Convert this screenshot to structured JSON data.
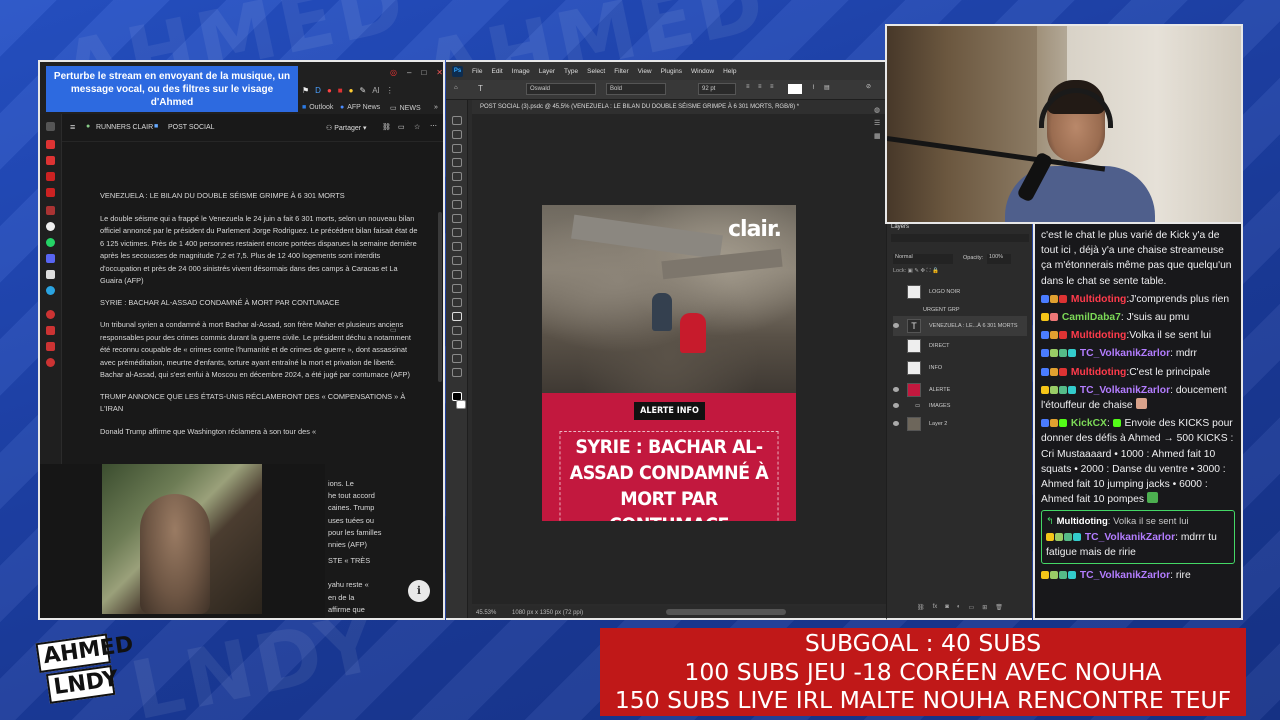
{
  "left_panel": {
    "banner_text": "Perturbe le stream en envoyant de la musique, un message vocal, ou des filtres sur le visage d'Ahmed",
    "bookmarks": [
      "Outlook",
      "AFP News",
      "NEWS"
    ],
    "breadcrumb": [
      "RUNNERS CLAIR",
      "POST SOCIAL"
    ],
    "share_label": "Partager",
    "doc": [
      {
        "type": "heading",
        "text": "VENEZUELA : LE BILAN DU DOUBLE SÉISME GRIMPE À 6 301 MORTS"
      },
      {
        "type": "para",
        "text": "Le double séisme qui a frappé le Venezuela le 24 juin a fait 6 301 morts, selon un nouveau bilan officiel annoncé par le président du Parlement Jorge Rodriguez. Le précédent bilan faisait état de 6 125 victimes. Près de 1 400 personnes restaient encore portées disparues la semaine dernière après les secousses de magnitude 7,2 et 7,5. Plus de 12 400 logements sont interdits d'occupation et près de 24 000 sinistrés vivent désormais dans des camps à Caracas et La Guaira (AFP)"
      },
      {
        "type": "heading",
        "text": "SYRIE : BACHAR AL-ASSAD CONDAMNÉ À MORT PAR CONTUMACE"
      },
      {
        "type": "para",
        "text": "Un tribunal syrien a condamné à mort Bachar al-Assad, son frère Maher et plusieurs anciens responsables pour des crimes commis durant la guerre civile. Le président déchu a notamment été reconnu coupable de « crimes contre l'humanité et de crimes de guerre », dont assassinat avec préméditation, meurtre d'enfants, torture ayant entraîné la mort et privation de liberté. Bachar al-Assad, qui s'est enfui à Moscou en décembre 2024, a été jugé par contumace (AFP)"
      },
      {
        "type": "heading",
        "text": "TRUMP ANNONCE QUE LES ÉTATS-UNIS RÉCLAMERONT DES « COMPENSATIONS » À L'IRAN"
      },
      {
        "type": "para",
        "text": "Donald Trump affirme que Washington réclamera à son tour des «"
      }
    ],
    "doc_fragments": [
      "ions. Le",
      "he tout accord",
      "caines. Trump",
      "uses tuées ou",
      "pour les familles",
      "nnies (AFP)",
      "STE « TRÈS",
      "yahu reste «",
      "en de la",
      "affirme que"
    ]
  },
  "photoshop": {
    "menu": [
      "File",
      "Edit",
      "Image",
      "Layer",
      "Type",
      "Select",
      "Filter",
      "View",
      "Plugins",
      "Window",
      "Help"
    ],
    "font_name": "Oswald",
    "font_style": "Bold",
    "font_size": "92 pt",
    "doc_tab": "POST SOCIAL (3).psdc @ 45,5% (VENEZUELA : LE BILAN DU DOUBLE SÉISME GRIMPE À 6 301 MORTS, RGB/8) *",
    "zoom": "45.53%",
    "doc_size": "1080 px x 1350 px (72 ppi)",
    "post": {
      "logo": "clair.",
      "label": "ALERTE INFO",
      "title": "SYRIE : BACHAR AL-ASSAD CONDAMNÉ À MORT PAR CONTUMACE"
    },
    "layers_title": "Layers",
    "blend_mode": "Normal",
    "opacity_label": "Opacity:",
    "opacity_value": "100%",
    "layers": [
      "LOGO NOIR",
      "URGENT GRP",
      "VENEZUELA : LE...À 6 301 MORTS",
      "DIRECT",
      "INFO",
      "ALERTE",
      "IMAGES",
      "Layer 2"
    ]
  },
  "chat": {
    "messages": [
      {
        "user": "",
        "text": "c'est le chat le plus varié de Kick y'a de tout ici , déjà y'a une chaise streameuse ça m'étonnerais même pas que quelqu'un dans le chat se sente table."
      },
      {
        "user": "Multidoting",
        "text": "J'comprends plus rien",
        "color": "u1"
      },
      {
        "user": "CamilDaba7",
        "text": "J'suis au pmu",
        "color": "u3"
      },
      {
        "user": "Multidoting",
        "text": "Volka il se sent lui",
        "color": "u1"
      },
      {
        "user": "TC_VolkanikZarlor",
        "text": "mdrr",
        "color": "u2"
      },
      {
        "user": "Multidoting",
        "text": "C'est le principale",
        "color": "u1"
      },
      {
        "user": "TC_VolkanikZarlor",
        "text": "doucement l'étouffeur de chaise",
        "color": "u2"
      },
      {
        "user": "KickCX",
        "text": "Envoie des KICKS pour donner des défis à Ahmed → 500 KICKS : Cri Mustaaaard • 1000 : Ahmed fait 10 squats • 2000 : Danse du ventre • 3000 : Ahmed fait 10 jumping jacks • 6000 : Ahmed fait 10 pompes",
        "color": "u3"
      }
    ],
    "reply": {
      "to_user": "Multidoting",
      "to_text": "Volka il se sent lui",
      "user": "TC_VolkanikZarlor",
      "text": "mdrrr tu fatigue mais de ririe"
    },
    "last": {
      "user": "TC_VolkanikZarlor",
      "text": "rire"
    }
  },
  "subgoal": {
    "lines": [
      "SUBGOAL : 40 SUBS",
      "100 SUBS JEU -18 CORÉEN AVEC NOUHA",
      "150 SUBS LIVE IRL MALTE NOUHA RENCONTRE TEUF"
    ]
  },
  "logo": {
    "line1": "AHMED",
    "line2": "LNDY"
  },
  "colors": {
    "subgoal_bg": "#c01818",
    "post_red": "#c2183e",
    "chat_bg": "#18181b",
    "background": "#1d3fa0"
  }
}
